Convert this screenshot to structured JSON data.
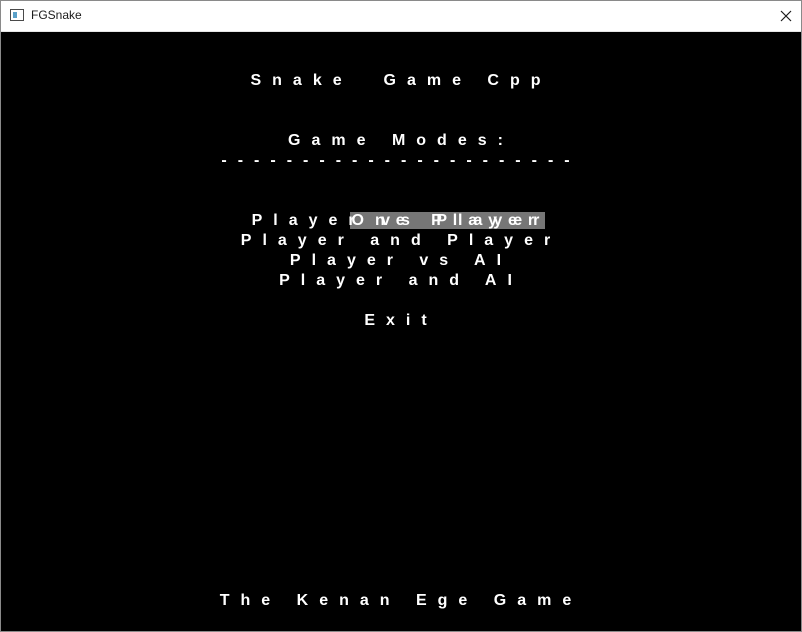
{
  "window": {
    "title": "FGSnake",
    "close_icon": "close-icon",
    "app_icon": "console-app-icon"
  },
  "console": {
    "game_title": "Snake  Game Cpp",
    "menu_header": "Game Modes:",
    "divider": "----------------------",
    "menu_items": [
      {
        "label": "One Player",
        "selected": true
      },
      {
        "label": "Player vs Player",
        "selected": false
      },
      {
        "label": "Player and Player",
        "selected": false
      },
      {
        "label": "Player vs AI",
        "selected": false
      },
      {
        "label": "Player and AI",
        "selected": false
      }
    ],
    "exit_label": "Exit",
    "footer": "The Kenan Ege Game"
  },
  "colors": {
    "background": "#000000",
    "text": "#ffffff",
    "selection_highlight": "#767676"
  }
}
